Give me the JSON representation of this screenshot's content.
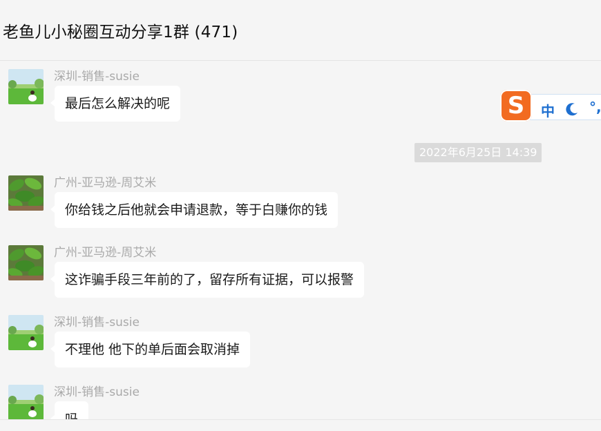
{
  "header": {
    "title": "老鱼儿小秘圈互动分享1群 (471)"
  },
  "messages": [
    {
      "sender": "深圳-销售-susie",
      "text": "最后怎么解决的呢",
      "avatar": "grass-field-avatar"
    },
    {
      "sender": "广州-亚马逊-周艾米",
      "text": "你给钱之后他就会申请退款，等于白赚你的钱",
      "avatar": "plant-leaves-avatar"
    },
    {
      "sender": "广州-亚马逊-周艾米",
      "text": "这诈骗手段三年前的了，留存所有证据，可以报警",
      "avatar": "plant-leaves-avatar"
    },
    {
      "sender": "深圳-销售-susie",
      "text": "不理他 他下的单后面会取消掉",
      "avatar": "grass-field-avatar"
    },
    {
      "sender": "深圳-销售-susie",
      "text": "吗",
      "avatar": "grass-field-avatar"
    }
  ],
  "timestamp": "2022年6月25日 14:39",
  "ime": {
    "logo_letter": "S",
    "mode_label": "中",
    "punct_label": "°,"
  },
  "colors": {
    "ime_orange": "#f26b21",
    "ime_blue": "#1e6fd0",
    "bubble": "#ffffff",
    "background": "#f5f5f5"
  }
}
